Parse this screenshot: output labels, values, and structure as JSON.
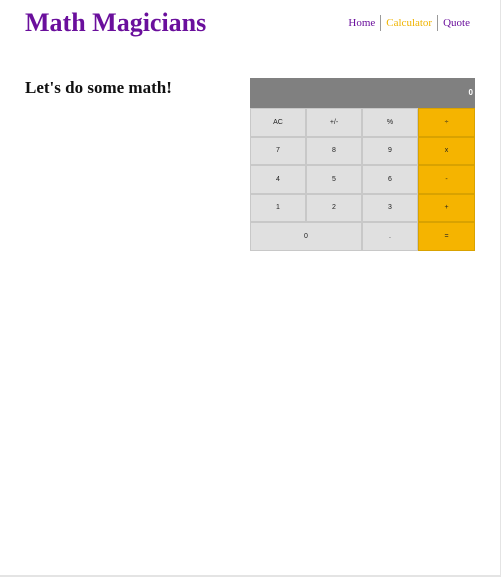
{
  "header": {
    "brand": "Math Magicians",
    "nav": [
      {
        "label": "Home",
        "active": false
      },
      {
        "label": "Calculator",
        "active": true
      },
      {
        "label": "Quote",
        "active": false
      }
    ]
  },
  "main": {
    "heading": "Let's do some math!"
  },
  "calculator": {
    "display": "0",
    "keys": {
      "ac": "AC",
      "sign": "+/-",
      "percent": "%",
      "divide": "÷",
      "seven": "7",
      "eight": "8",
      "nine": "9",
      "multiply": "x",
      "four": "4",
      "five": "5",
      "six": "6",
      "minus": "-",
      "one": "1",
      "two": "2",
      "three": "3",
      "plus": "+",
      "zero": "0",
      "dot": ".",
      "equals": "="
    }
  },
  "colors": {
    "brand": "#6a0f9c",
    "active_nav": "#f0b400",
    "display_bg": "#808080",
    "key_bg": "#e0e0e0",
    "operator_bg": "#f5b400"
  }
}
